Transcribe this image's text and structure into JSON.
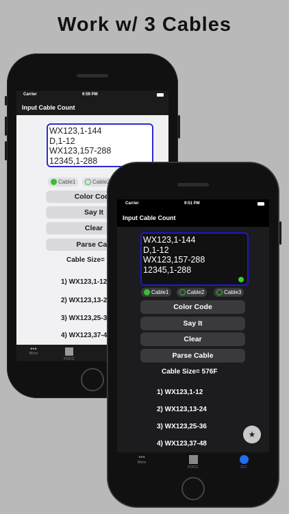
{
  "headline": "Work w/ 3 Cables",
  "back_phone": {
    "status": {
      "carrier": "Carrier",
      "time": "9:59 PM"
    },
    "nav_title": "Input Cable Count",
    "text_lines": "WX123,1-144\nD,1-12\nWX123,157-288\n12345,1-288",
    "radios": [
      "Cable1",
      "Cable2"
    ],
    "buttons": [
      "Color Code",
      "Say It",
      "Clear",
      "Parse Cab"
    ],
    "size_label": "Cable Size=",
    "items": [
      "1) WX123,1-12",
      "2) WX123,13-2",
      "3) WX123,25-3",
      "4) WX123,37-4"
    ],
    "tabs": [
      "More",
      "FOCC"
    ]
  },
  "front_phone": {
    "status": {
      "carrier": "Carrier",
      "time": "9:51 PM"
    },
    "nav_title": "Input Cable Count",
    "text_lines": "WX123,1-144\nD,1-12\nWX123,157-288\n12345,1-288",
    "radios": [
      "Cable1",
      "Cable2",
      "Cable3"
    ],
    "buttons": [
      "Color Code",
      "Say It",
      "Clear",
      "Parse Cable"
    ],
    "size_label": "Cable Size= 576F",
    "items": [
      "1) WX123,1-12",
      "2) WX123,13-24",
      "3) WX123,25-36",
      "4) WX123,37-48"
    ],
    "tabs": [
      "More",
      "FOCC",
      "ICC"
    ],
    "fab_icon": "star-icon"
  }
}
